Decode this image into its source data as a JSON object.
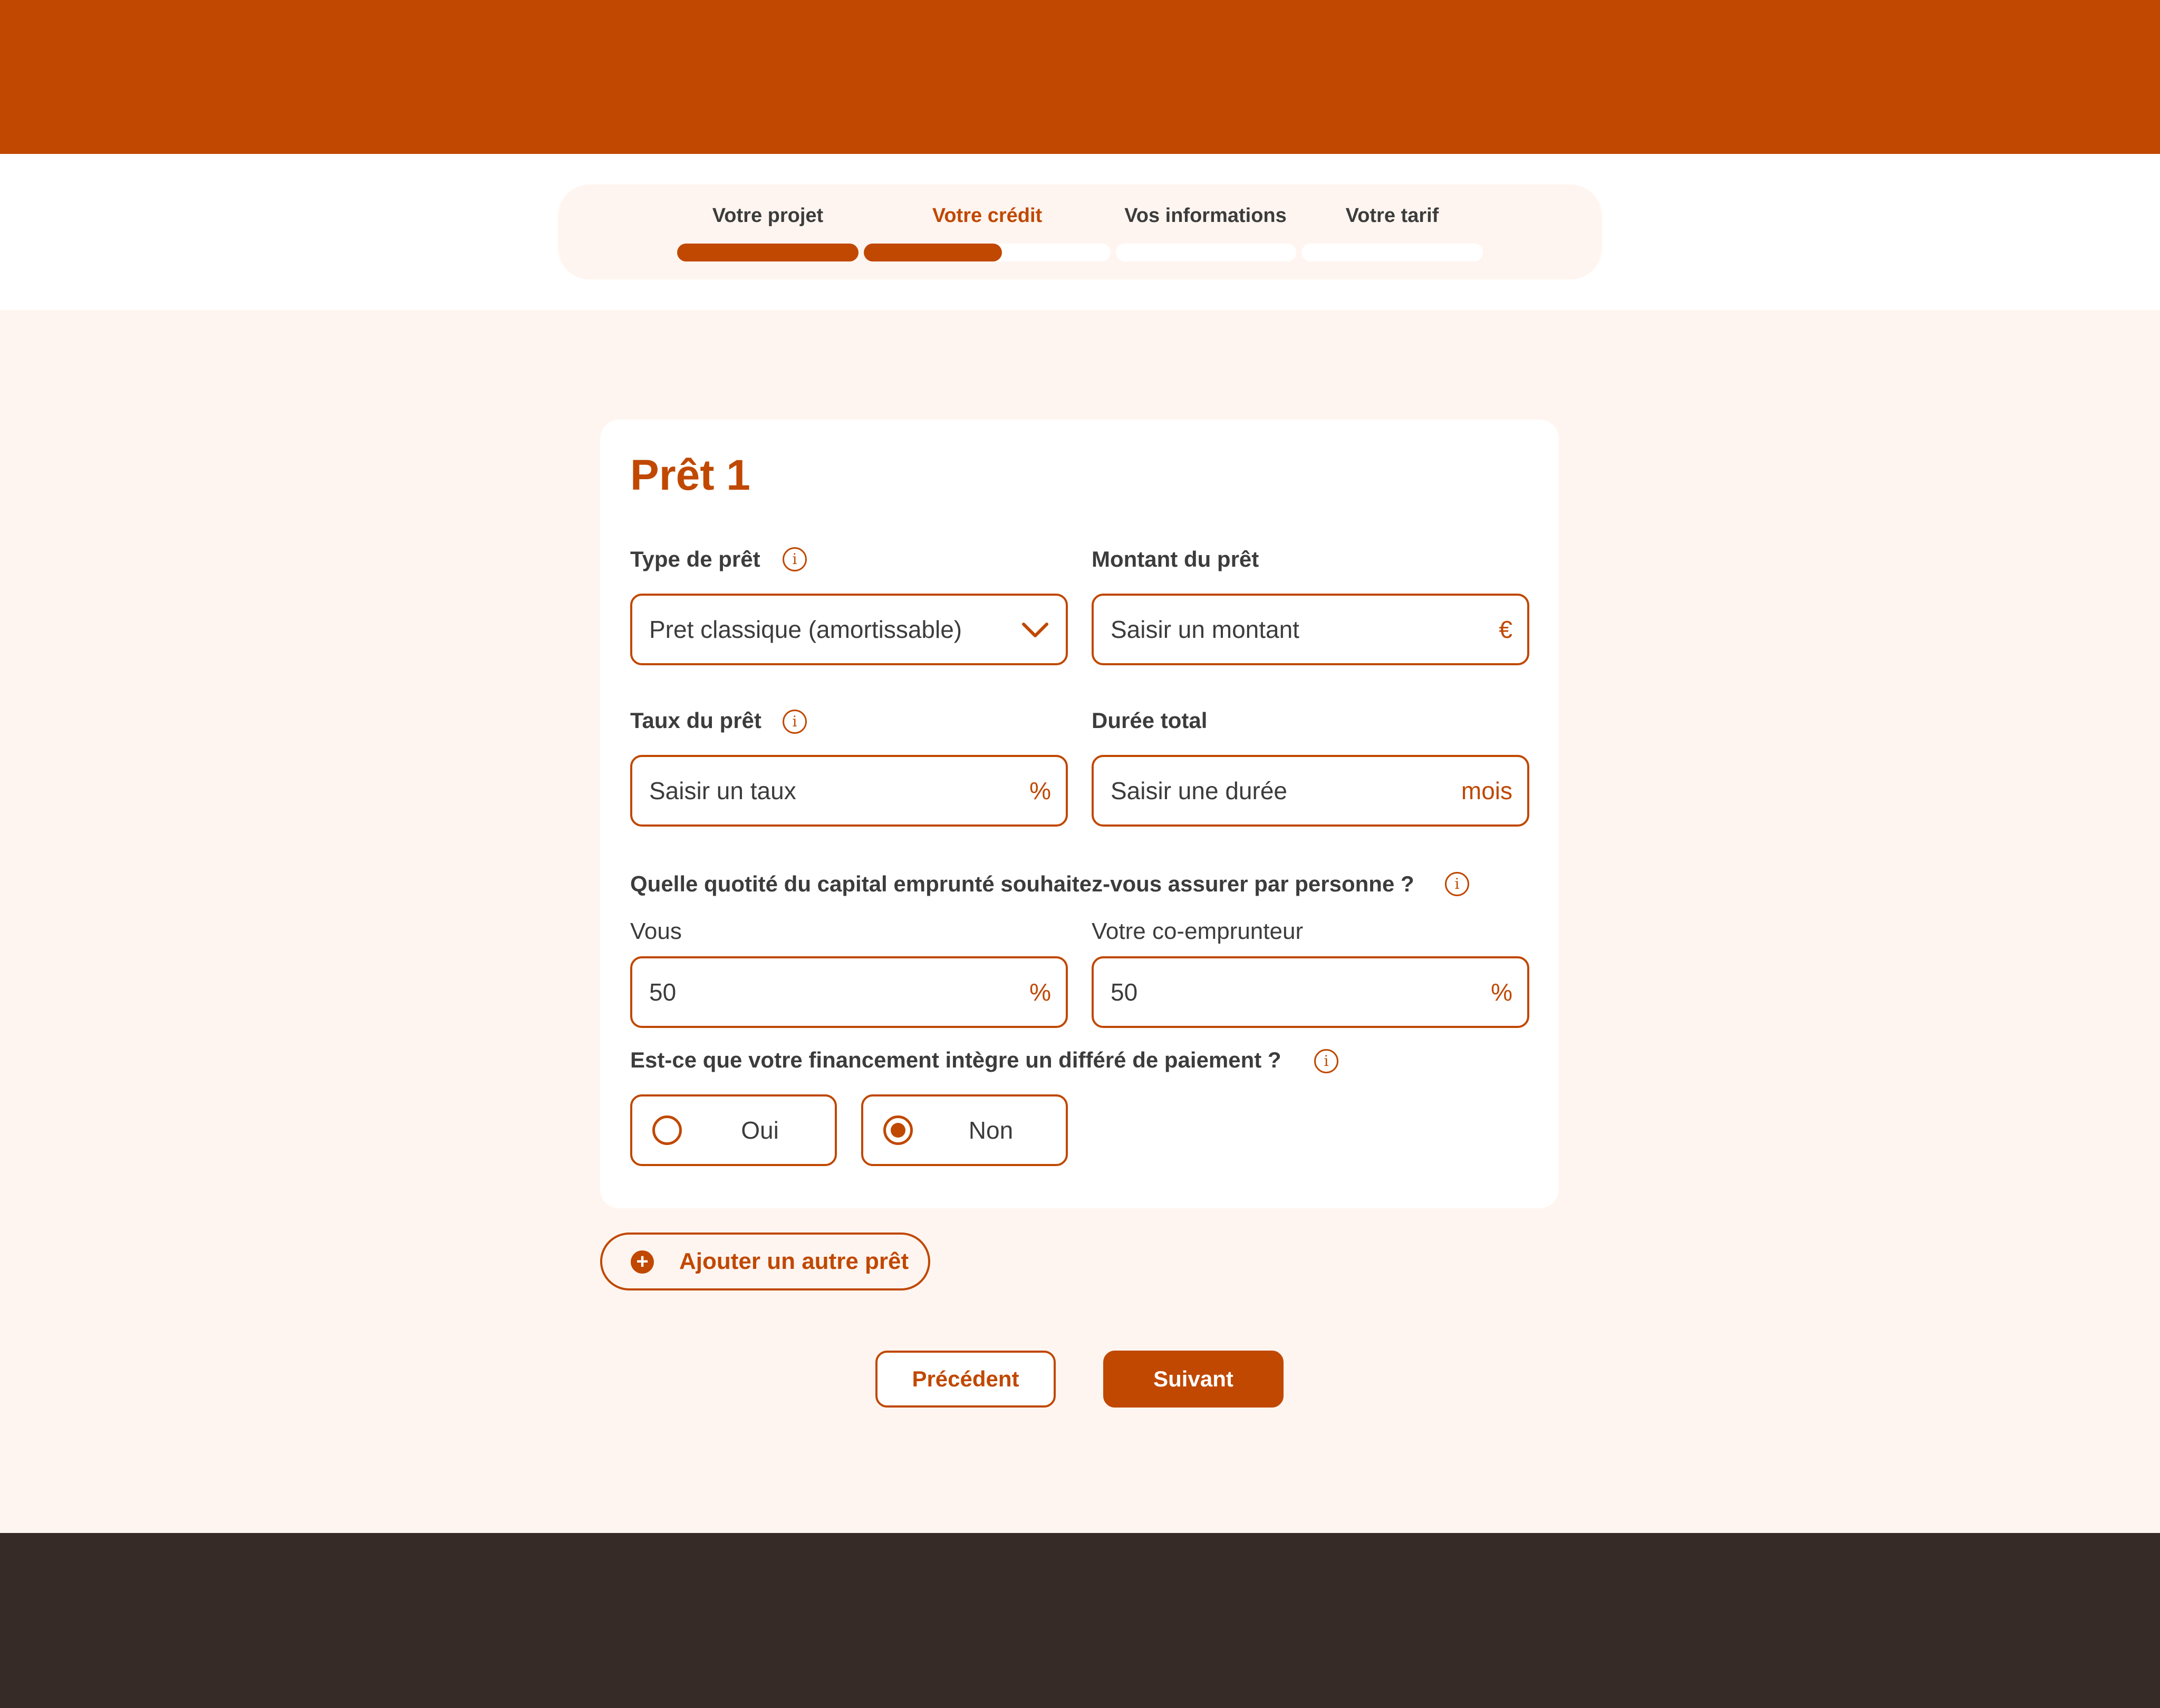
{
  "stepper": {
    "steps": [
      {
        "label": "Votre projet",
        "progress": 1.0,
        "active": false
      },
      {
        "label": "Votre crédit",
        "progress": 0.56,
        "active": true
      },
      {
        "label": "Vos informations",
        "progress": 0,
        "active": false
      },
      {
        "label": "Votre tarif",
        "progress": 0,
        "active": false
      }
    ]
  },
  "loan": {
    "title": "Prêt 1",
    "type": {
      "label": "Type de prêt",
      "value": "Pret classique (amortissable)"
    },
    "amount": {
      "label": "Montant du prêt",
      "placeholder": "Saisir un montant",
      "suffix": "€"
    },
    "rate": {
      "label": "Taux du prêt",
      "placeholder": "Saisir un taux",
      "suffix": "%"
    },
    "duration": {
      "label": "Durée total",
      "placeholder": "Saisir une durée",
      "suffix": "mois"
    },
    "quotity": {
      "question": "Quelle quotité du capital emprunté souhaitez-vous assurer par personne ?",
      "you": {
        "label": "Vous",
        "value": "50"
      },
      "coborrower": {
        "label": "Votre co-emprunteur",
        "value": "50"
      }
    },
    "deferral": {
      "question": "Est-ce que votre financement intègre un différé de paiement ?",
      "options": [
        {
          "label": "Oui",
          "selected": false
        },
        {
          "label": "Non",
          "selected": true
        }
      ]
    }
  },
  "actions": {
    "add_loan": "Ajouter un autre prêt",
    "previous": "Précédent",
    "next": "Suivant"
  },
  "colors": {
    "accent": "#c04800",
    "background": "#fff5f0",
    "footer": "#362b27"
  }
}
